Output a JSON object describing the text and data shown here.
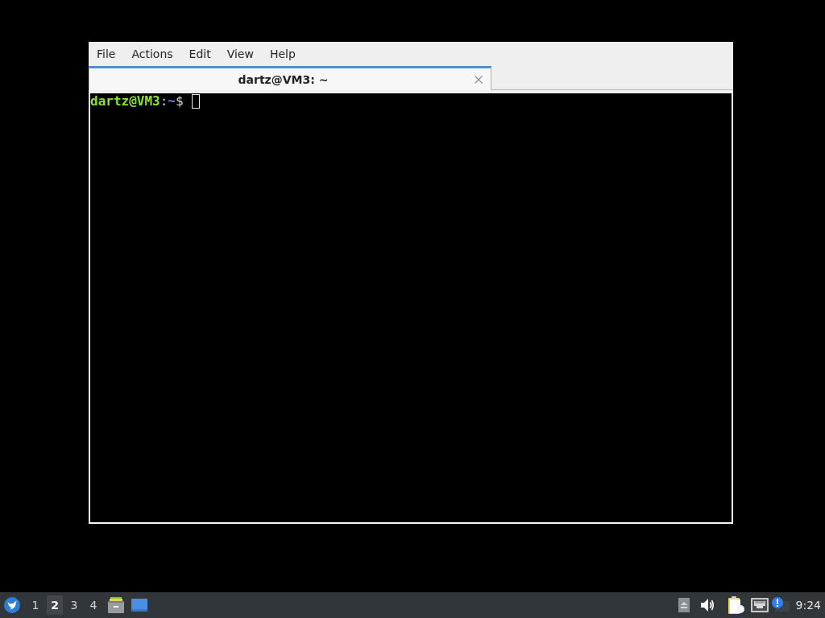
{
  "window": {
    "menu": [
      "File",
      "Actions",
      "Edit",
      "View",
      "Help"
    ],
    "tabs": [
      {
        "title": "dartz@VM3: ~",
        "selected": true
      }
    ],
    "terminal": {
      "prompt": [
        {
          "text": "dartz@VM3",
          "kind": "user"
        },
        {
          "text": ":",
          "kind": "plain"
        },
        {
          "text": "~",
          "kind": "path"
        },
        {
          "text": "$",
          "kind": "plain"
        }
      ]
    }
  },
  "taskbar": {
    "workspaces": [
      {
        "label": "1",
        "selected": false
      },
      {
        "label": "2",
        "selected": true
      },
      {
        "label": "3",
        "selected": false
      },
      {
        "label": "4",
        "selected": false
      }
    ],
    "clock": "9:24"
  }
}
